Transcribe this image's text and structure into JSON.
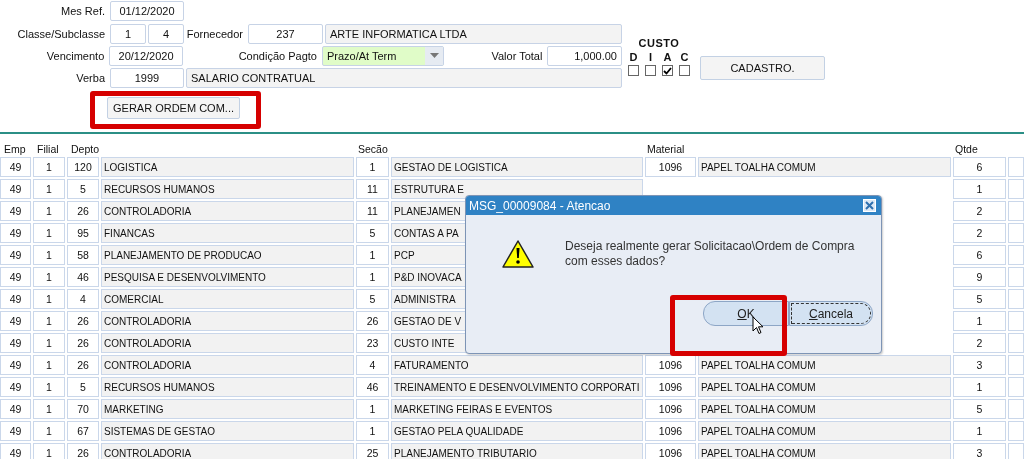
{
  "form": {
    "mes_ref": {
      "label": "Mes Ref.",
      "value": "01/12/2020"
    },
    "classe": {
      "label": "Classe/Subclasse",
      "classe": "1",
      "subclasse": "4"
    },
    "fornecedor": {
      "label": "Fornecedor",
      "code": "237",
      "name": "ARTE INFORMATICA LTDA"
    },
    "vencimento": {
      "label": "Vencimento",
      "value": "20/12/2020"
    },
    "condicao": {
      "label": "Condição Pagto",
      "value": "Prazo/At Term"
    },
    "valor_total": {
      "label": "Valor Total",
      "value": "1,000.00"
    },
    "verba": {
      "label": "Verba",
      "code": "1999",
      "name": "SALARIO CONTRATUAL"
    },
    "gerar_button": "GERAR ORDEM COM..."
  },
  "custo": {
    "title": "CUSTO",
    "options": [
      {
        "label": "D",
        "checked": false
      },
      {
        "label": "I",
        "checked": false
      },
      {
        "label": "A",
        "checked": true
      },
      {
        "label": "C",
        "checked": false
      }
    ]
  },
  "cadastro_button": "CADASTRO.",
  "table": {
    "columns": [
      "Emp",
      "Filial",
      "Depto",
      "",
      "Secão",
      "",
      "Material",
      "",
      "Qtde",
      ""
    ],
    "rows": [
      {
        "emp": "49",
        "filial": "1",
        "depto": "120",
        "departamento": "LOGISTICA",
        "secao": "1",
        "secao_desc": "GESTAO DE LOGISTICA",
        "material": "1096",
        "material_desc": "PAPEL TOALHA COMUM",
        "qtde": "6"
      },
      {
        "emp": "49",
        "filial": "1",
        "depto": "5",
        "departamento": "RECURSOS HUMANOS",
        "secao": "11",
        "secao_desc": "ESTRUTURA E",
        "qtde": "1"
      },
      {
        "emp": "49",
        "filial": "1",
        "depto": "26",
        "departamento": "CONTROLADORIA",
        "secao": "11",
        "secao_desc": "PLANEJAMEN",
        "qtde": "2"
      },
      {
        "emp": "49",
        "filial": "1",
        "depto": "95",
        "departamento": "FINANCAS",
        "secao": "5",
        "secao_desc": "CONTAS A PA",
        "qtde": "2"
      },
      {
        "emp": "49",
        "filial": "1",
        "depto": "58",
        "departamento": "PLANEJAMENTO DE PRODUCAO",
        "secao": "1",
        "secao_desc": "PCP",
        "qtde": "6"
      },
      {
        "emp": "49",
        "filial": "1",
        "depto": "46",
        "departamento": "PESQUISA E DESENVOLVIMENTO",
        "secao": "1",
        "secao_desc": "P&D INOVACA",
        "qtde": "9"
      },
      {
        "emp": "49",
        "filial": "1",
        "depto": "4",
        "departamento": "COMERCIAL",
        "secao": "5",
        "secao_desc": "ADMINISTRA",
        "qtde": "5"
      },
      {
        "emp": "49",
        "filial": "1",
        "depto": "26",
        "departamento": "CONTROLADORIA",
        "secao": "26",
        "secao_desc": "GESTAO DE V",
        "qtde": "1"
      },
      {
        "emp": "49",
        "filial": "1",
        "depto": "26",
        "departamento": "CONTROLADORIA",
        "secao": "23",
        "secao_desc": "CUSTO INTE",
        "qtde": "2"
      },
      {
        "emp": "49",
        "filial": "1",
        "depto": "26",
        "departamento": "CONTROLADORIA",
        "secao": "4",
        "secao_desc": "FATURAMENTO",
        "material": "1096",
        "material_desc": "PAPEL TOALHA COMUM",
        "qtde": "3"
      },
      {
        "emp": "49",
        "filial": "1",
        "depto": "5",
        "departamento": "RECURSOS HUMANOS",
        "secao": "46",
        "secao_desc": "TREINAMENTO E DESENVOLVIMENTO CORPORATI",
        "material": "1096",
        "material_desc": "PAPEL TOALHA COMUM",
        "qtde": "1"
      },
      {
        "emp": "49",
        "filial": "1",
        "depto": "70",
        "departamento": "MARKETING",
        "secao": "1",
        "secao_desc": "MARKETING FEIRAS E EVENTOS",
        "material": "1096",
        "material_desc": "PAPEL TOALHA COMUM",
        "qtde": "5"
      },
      {
        "emp": "49",
        "filial": "1",
        "depto": "67",
        "departamento": "SISTEMAS DE GESTAO",
        "secao": "1",
        "secao_desc": "GESTAO PELA QUALIDADE",
        "material": "1096",
        "material_desc": "PAPEL TOALHA COMUM",
        "qtde": "1"
      },
      {
        "emp": "49",
        "filial": "1",
        "depto": "26",
        "departamento": "CONTROLADORIA",
        "secao": "25",
        "secao_desc": "PLANEJAMENTO TRIBUTARIO",
        "material": "1096",
        "material_desc": "PAPEL TOALHA COMUM",
        "qtde": "3"
      }
    ]
  },
  "dialog": {
    "title": "MSG_00009084 - Atencao",
    "message": "Deseja realmente gerar Solicitacao\\Ordem de Compra com esses dados?",
    "buttons": [
      {
        "label": "OK",
        "focused": false
      },
      {
        "label": "Cancela",
        "focused": true
      }
    ]
  }
}
